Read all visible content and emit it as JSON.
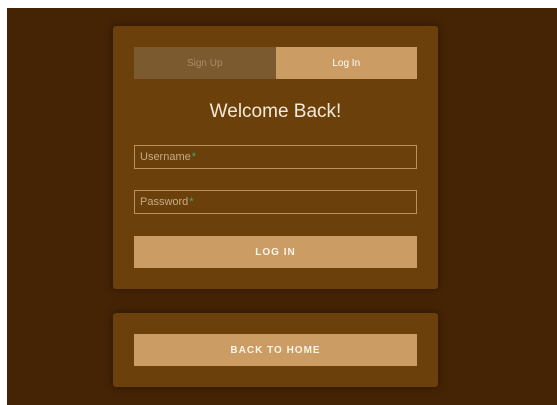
{
  "tabs": {
    "signup_label": "Sign Up",
    "login_label": "Log In",
    "active": "login"
  },
  "form": {
    "heading": "Welcome Back!",
    "username_label": "Username",
    "password_label": "Password",
    "required_mark": "*",
    "submit_label": "LOG IN"
  },
  "home": {
    "back_label": "BACK TO HOME"
  },
  "colors": {
    "background": "#452405",
    "panel": "#6b400b",
    "accent": "#cb9c63",
    "inactive_tab": "#7c5a30",
    "required": "#3fae6b"
  }
}
